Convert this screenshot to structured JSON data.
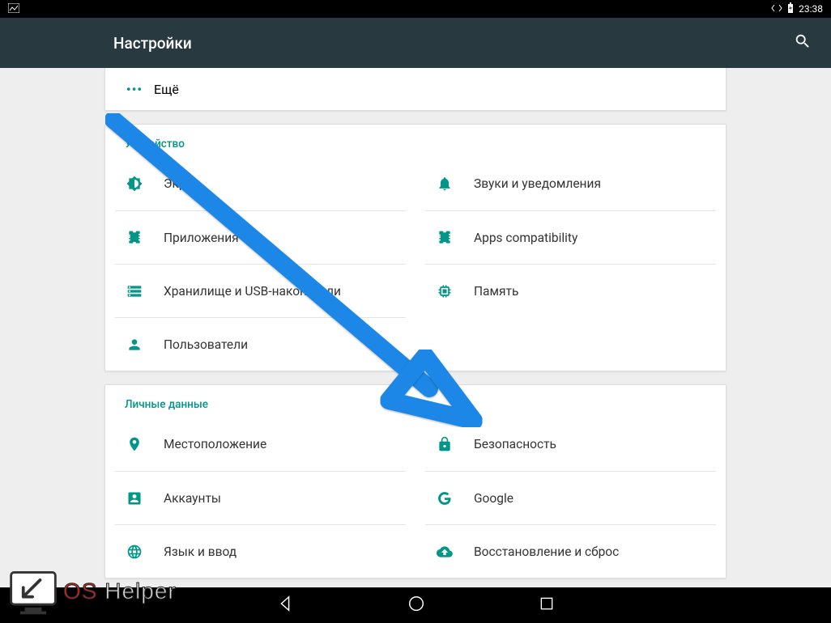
{
  "status": {
    "time": "23:38"
  },
  "title": "Настройки",
  "more_label": "Ещё",
  "sections": {
    "device": {
      "header": "Устройство",
      "left": [
        {
          "name": "display",
          "label": "Экран"
        },
        {
          "name": "apps",
          "label": "Приложения"
        },
        {
          "name": "storage",
          "label": "Хранилище и USB-накопители"
        },
        {
          "name": "users",
          "label": "Пользователи"
        }
      ],
      "right": [
        {
          "name": "sound",
          "label": "Звуки и уведомления"
        },
        {
          "name": "appcomp",
          "label": "Apps compatibility"
        },
        {
          "name": "memory",
          "label": "Память"
        }
      ]
    },
    "personal": {
      "header": "Личные данные",
      "left": [
        {
          "name": "location",
          "label": "Местоположение"
        },
        {
          "name": "accounts",
          "label": "Аккаунты"
        },
        {
          "name": "language",
          "label": "Язык и ввод"
        }
      ],
      "right": [
        {
          "name": "security",
          "label": "Безопасность"
        },
        {
          "name": "google",
          "label": "Google"
        },
        {
          "name": "backup",
          "label": "Восстановление и сброс"
        }
      ]
    }
  },
  "watermark": {
    "os": "OS",
    "helper": "Helper"
  }
}
